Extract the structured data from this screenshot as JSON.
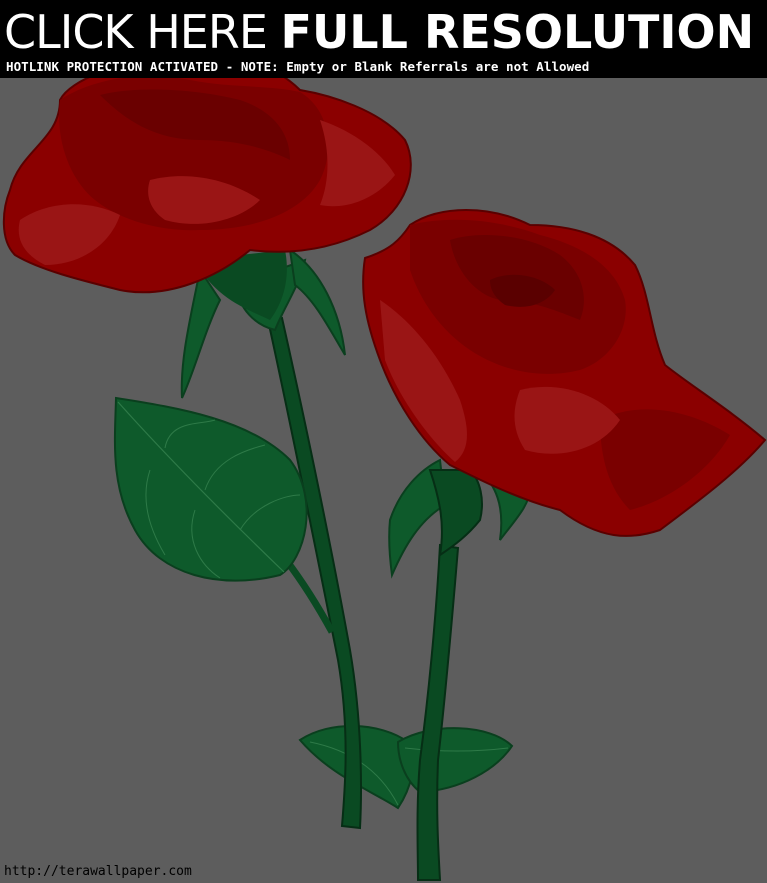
{
  "banner": {
    "headline_light": "CLICK HERE",
    "headline_bold": "FULL RESOLUTION",
    "notice": "HOTLINK PROTECTION ACTIVATED - NOTE: Empty or Blank Referrals are not Allowed"
  },
  "watermark": "http://terawallpaper.com",
  "colors": {
    "background": "#5d5d5d",
    "banner_background": "#000000",
    "banner_text": "#ffffff",
    "rose_red": "#8b0000",
    "rose_dark": "#6d0000",
    "leaf_green": "#0e5a2b",
    "stem_green": "#0a4a22"
  }
}
